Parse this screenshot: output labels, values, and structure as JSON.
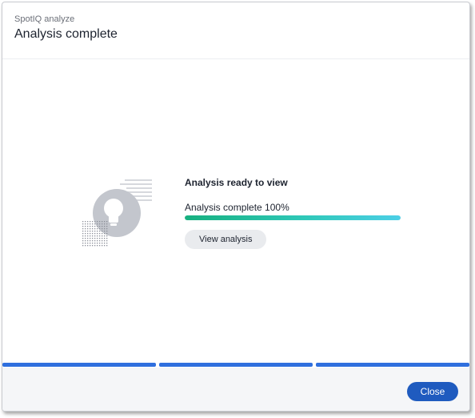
{
  "header": {
    "subtitle": "SpotIQ analyze",
    "title": "Analysis complete"
  },
  "illustration": {
    "icon": "lightbulb-icon"
  },
  "content": {
    "ready_text": "Analysis ready to view",
    "progress_label": "Analysis complete 100%",
    "progress_value": 1.0,
    "view_button_label": "View analysis"
  },
  "steps": {
    "count": 3,
    "completed": 3
  },
  "footer": {
    "close_label": "Close"
  },
  "colors": {
    "accent": "#1f5bbf",
    "step_bar": "#2f6fde",
    "progress_start": "#17b07f",
    "progress_end": "#4ccfe6"
  }
}
